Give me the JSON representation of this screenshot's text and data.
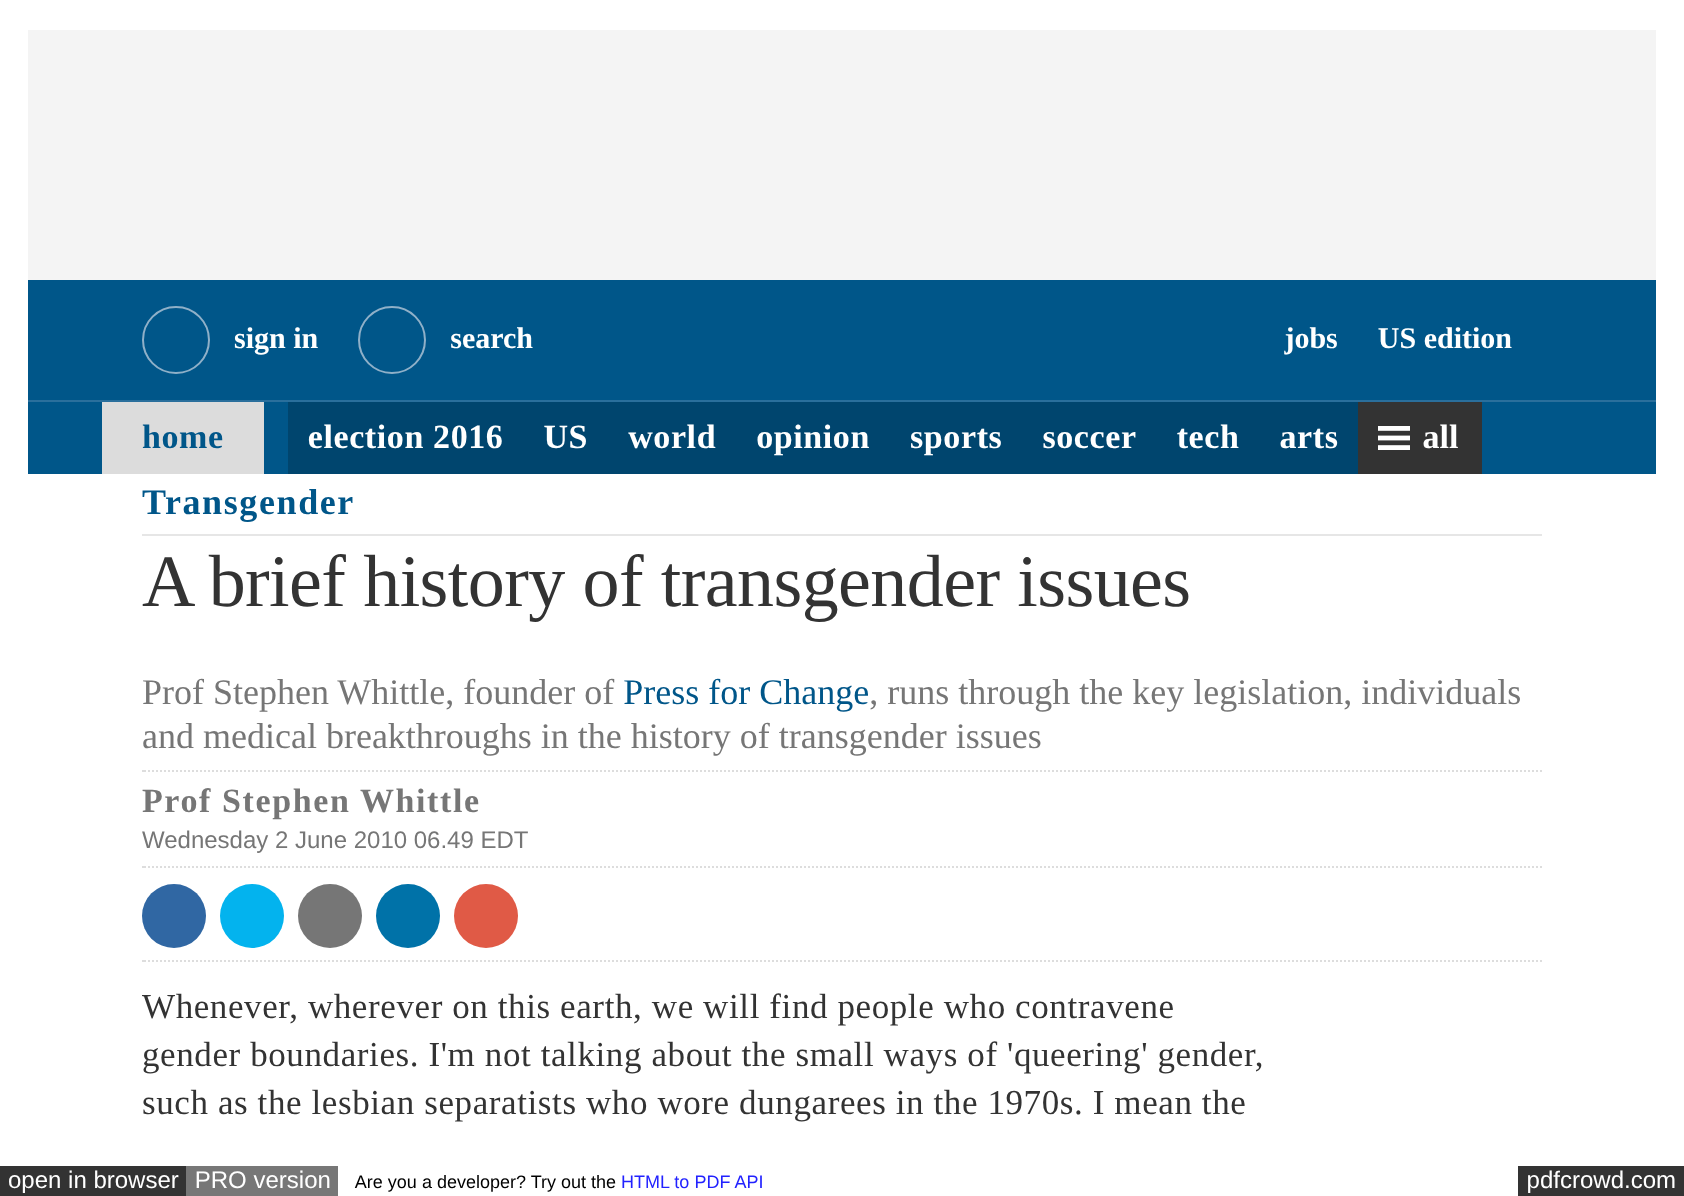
{
  "top_bar": {
    "sign_in": "sign in",
    "search": "search",
    "links": [
      "jobs",
      "US edition"
    ]
  },
  "nav": [
    {
      "label": "home",
      "selected": true
    },
    {
      "label": "election 2016",
      "selected": false
    },
    {
      "label": "US",
      "selected": false
    },
    {
      "label": "world",
      "selected": false
    },
    {
      "label": "opinion",
      "selected": false
    },
    {
      "label": "sports",
      "selected": false
    },
    {
      "label": "soccer",
      "selected": false
    },
    {
      "label": "tech",
      "selected": false
    },
    {
      "label": "arts",
      "selected": false
    }
  ],
  "all_button": "all",
  "article": {
    "section": "Transgender",
    "headline": "A brief history of transgender issues",
    "standfirst": {
      "before": "Prof Stephen Whittle, founder of ",
      "link": "Press for Change",
      "after": ", runs through the key legislation, individuals and medical breakthroughs in the history of transgender issues"
    },
    "byline": "Prof Stephen Whittle",
    "dateline": "Wednesday 2 June 2010 06.49 EDT",
    "share": [
      {
        "color": "#3067a3"
      },
      {
        "color": "#03b3ee"
      },
      {
        "color": "#767676"
      },
      {
        "color": "#0072a8"
      },
      {
        "color": "#e05a46"
      }
    ],
    "body_lines": [
      "Whenever, wherever on this earth, we will find people who contravene",
      "gender boundaries. I'm not talking about the small ways of 'queering' gender,",
      "such as the lesbian separatists who wore dungarees in the 1970s. I mean the"
    ]
  },
  "footer": {
    "open": "open in browser",
    "pro": "PRO version",
    "promo": "Are you a developer? Try out the ",
    "promo_link": "HTML to PDF API",
    "brand": "pdfcrowd.com"
  }
}
